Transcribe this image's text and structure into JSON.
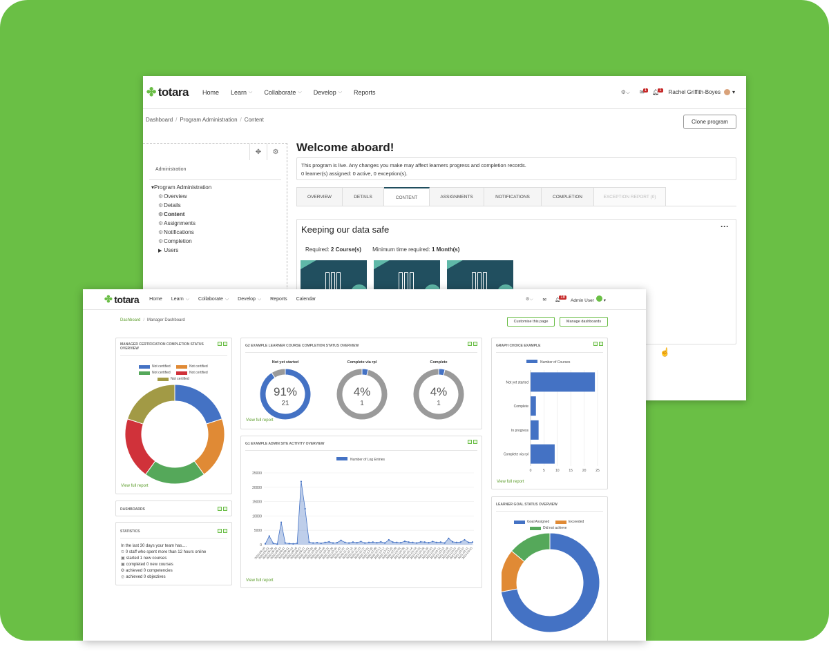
{
  "colors": {
    "background": "#6abf45",
    "accent_dark": "#1f4e5e",
    "link_green": "#5b9c2a",
    "blue": "#4472c4",
    "orange": "#e08a35",
    "green": "#55a85a",
    "red": "#d0323a",
    "olive": "#a29a45",
    "grey": "#9a9a9a"
  },
  "back": {
    "nav": {
      "logo": "totara",
      "items": [
        "Home",
        "Learn",
        "Collaborate",
        "Develop",
        "Reports"
      ],
      "user": "Rachel Griffith-Boyes",
      "msg_badge": "1",
      "notif_badge": "1"
    },
    "breadcrumb": [
      "Dashboard",
      "Program Administration",
      "Content"
    ],
    "clone_button": "Clone program",
    "sidebar": {
      "title": "Administration",
      "root": "Program Administration",
      "children": [
        "Overview",
        "Details",
        "Content",
        "Assignments",
        "Notifications",
        "Completion"
      ],
      "users": "Users"
    },
    "page_title": "Welcome aboard!",
    "notice_line1": "This program is live. Any changes you make may affect learners progress and completion records.",
    "notice_line2": "0 learner(s) assigned: 0 active, 0 exception(s).",
    "tabs": [
      "OVERVIEW",
      "DETAILS",
      "CONTENT",
      "ASSIGNMENTS",
      "NOTIFICATIONS",
      "COMPLETION",
      "EXCEPTION REPORT (0)"
    ],
    "panel": {
      "title": "Keeping our data safe",
      "required_label": "Required:",
      "required_value": "2 Course(s)",
      "min_time_label": "Minimum time required:",
      "min_time_value": "1 Month(s)"
    }
  },
  "front": {
    "nav": {
      "logo": "totara",
      "items": [
        "Home",
        "Learn",
        "Collaborate",
        "Develop",
        "Reports",
        "Calendar"
      ],
      "user": "Admin User",
      "notif_badge": "18"
    },
    "breadcrumb": [
      "Dashboard",
      "Manager Dashboard"
    ],
    "customise_button": "Customise this page",
    "manage_button": "Manage dashboards",
    "view_full_report": "View full report",
    "blocks": {
      "cert_title": "MANAGER CERTIFICATION COMPLETION STATUS OVERVIEW",
      "course_title": "G2 EXAMPLE LEARNER COURSE COMPLETION STATUS OVERVIEW",
      "graph_title": "GRAPH CHOICE EXAMPLE",
      "activity_title": "G1 EXAMPLE ADMIN SITE ACTIVITY OVERVIEW",
      "dashboards_title": "DASHBOARDS",
      "statistics_title": "STATISTICS",
      "goal_title": "LEARNER GOAL STATUS OVERVIEW"
    },
    "statistics": {
      "intro": "In the last 30 days your team has....",
      "items": [
        "0 staff who spent more than 12 hours online",
        "started 1 new courses",
        "completed 0 new courses",
        "achieved 0 competencies",
        "achieved 0 objectives"
      ]
    }
  },
  "chart_data": [
    {
      "type": "pie",
      "title": "MANAGER CERTIFICATION COMPLETION STATUS OVERVIEW",
      "labels": [
        "Not certified",
        "Not certified",
        "Not certified",
        "Not certified",
        "Not certified"
      ],
      "colors": [
        "#4472c4",
        "#e08a35",
        "#55a85a",
        "#d0323a",
        "#a29a45"
      ],
      "values": [
        20,
        20,
        20,
        20,
        20
      ]
    },
    {
      "type": "pie",
      "title": "G2 EXAMPLE LEARNER COURSE COMPLETION STATUS OVERVIEW",
      "donuts": [
        {
          "label": "Not yet started",
          "percent": 91,
          "count": 21
        },
        {
          "label": "Complete via rpl",
          "percent": 4,
          "count": 1
        },
        {
          "label": "Complete",
          "percent": 4,
          "count": 1
        }
      ]
    },
    {
      "type": "bar",
      "title": "GRAPH CHOICE EXAMPLE",
      "legend": "Number of Courses",
      "categories": [
        "Not yet started",
        "Complete",
        "In progress",
        "Complete via rpl"
      ],
      "values": [
        24,
        2,
        3,
        9
      ],
      "xticks": [
        0,
        5,
        10,
        15,
        20,
        25
      ],
      "xlim": [
        0,
        25
      ]
    },
    {
      "type": "line",
      "title": "G1 EXAMPLE ADMIN SITE ACTIVITY OVERVIEW",
      "legend": "Number of Log Entries",
      "ylim": [
        0,
        25000
      ],
      "yticks": [
        0,
        5000,
        10000,
        15000,
        20000,
        25000
      ],
      "xticks": [
        "2020-08-18",
        "2020-08-22",
        "2020-08-26",
        "2020-08-30",
        "2020-09-03",
        "2020-09-07",
        "2020-09-11",
        "2020-09-15",
        "2020-09-19",
        "2020-09-23",
        "2020-09-27",
        "2020-10-01",
        "2020-10-05",
        "2020-10-09",
        "2020-10-14",
        "2020-10-18",
        "2020-10-22",
        "2020-10-26",
        "2020-10-30",
        "2020-11-03",
        "2020-11-07",
        "2020-11-11",
        "2020-11-15",
        "2020-11-19",
        "2020-11-23",
        "2020-11-27",
        "2020-12-01",
        "2020-12-05",
        "2020-12-09",
        "2020-12-13",
        "2020-12-17",
        "2020-12-21",
        "2020-12-25",
        "2020-12-29",
        "2021-01-02",
        "2021-01-06",
        "2021-01-10",
        "2021-01-14",
        "2021-01-18",
        "2021-01-22",
        "2021-01-26",
        "2021-01-30",
        "2021-02-03",
        "2021-02-07",
        "2021-02-11",
        "2021-02-15",
        "2021-02-19",
        "2021-02-23",
        "2021-02-27",
        "2021-03-03",
        "2021-03-07",
        "2021-03-11",
        "2021-03-15"
      ],
      "values": [
        300,
        3000,
        500,
        200,
        7800,
        600,
        400,
        300,
        500,
        22000,
        12500,
        900,
        600,
        700,
        500,
        800,
        1000,
        600,
        700,
        1500,
        800,
        600,
        900,
        700,
        1100,
        600,
        800,
        900,
        700,
        1000,
        600,
        1700,
        900,
        800,
        700,
        1200,
        900,
        800,
        600,
        1000,
        900,
        700,
        1100,
        800,
        900,
        600,
        2200,
        1000,
        800,
        900,
        1700,
        800,
        900
      ]
    },
    {
      "type": "pie",
      "title": "LEARNER GOAL STATUS OVERVIEW",
      "labels": [
        "Goal Assigned",
        "Exceeded",
        "Did not achieve"
      ],
      "colors": [
        "#4472c4",
        "#e08a35",
        "#55a85a"
      ],
      "values": [
        72,
        14,
        14
      ]
    }
  ]
}
